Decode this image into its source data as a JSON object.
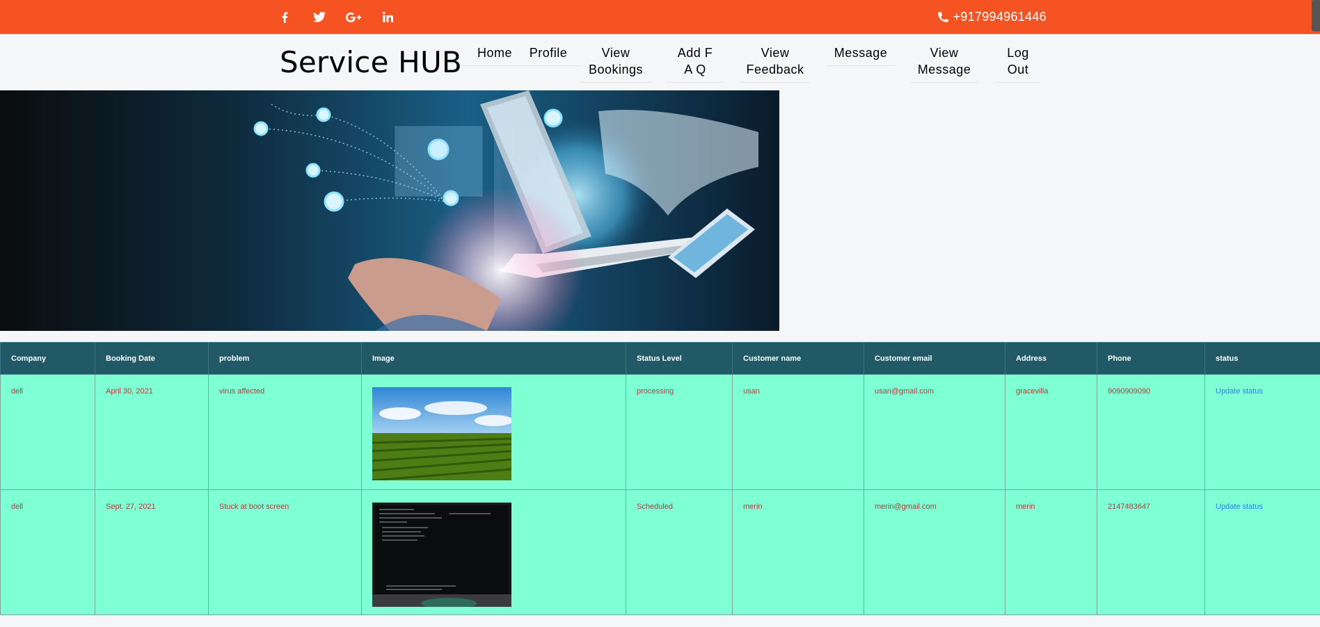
{
  "topbar": {
    "phone": "+917994961446",
    "social": [
      "facebook-icon",
      "twitter-icon",
      "google-plus-icon",
      "linkedin-icon"
    ]
  },
  "header": {
    "brand": "Service HUB",
    "nav": [
      {
        "line1": "Home",
        "line2": ""
      },
      {
        "line1": "Profile",
        "line2": ""
      },
      {
        "line1": "View",
        "line2": "Bookings"
      },
      {
        "line1": "Add F",
        "line2": "A Q"
      },
      {
        "line1": "View",
        "line2": "Feedback"
      },
      {
        "line1": "Message",
        "line2": ""
      },
      {
        "line1": "View",
        "line2": "Message"
      },
      {
        "line1": "Log",
        "line2": "Out"
      }
    ]
  },
  "table": {
    "headers": [
      "Company",
      "Booking Date",
      "problem",
      "Image",
      "Status Level",
      "Customer name",
      "Customer email",
      "Address",
      "Phone",
      "status"
    ],
    "rows": [
      {
        "company": "dell",
        "date": "April 30, 2021",
        "problem": "virus affected",
        "image": "field-photo",
        "status_level": "processing",
        "customer": "usan",
        "email": "usan@gmail.com",
        "address": "gracevilla",
        "phone": "9090909090",
        "action": "Update status"
      },
      {
        "company": "dell",
        "date": "Sept. 27, 2021",
        "problem": "Stuck at boot screen",
        "image": "boot-screen-photo",
        "status_level": "Scheduled",
        "customer": "merin",
        "email": "merin@gmail.com",
        "address": "merin",
        "phone": "2147483647",
        "action": "Update status"
      }
    ]
  },
  "colors": {
    "topbar": "#f65322",
    "table_header": "#215a66",
    "table_row": "#7fffd4",
    "cell_text": "#b13b3b",
    "link": "#2e7ef0"
  }
}
